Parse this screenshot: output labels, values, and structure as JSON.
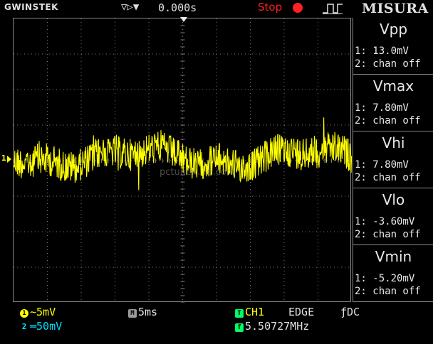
{
  "header": {
    "brand_prefix": "GW",
    "brand_suffix": "INSTEK",
    "timebase_arrows": "▽▷▼",
    "trigger_position": "0.000s",
    "run_state": "Stop",
    "menu_title": "MISURA"
  },
  "measurements": [
    {
      "title": "Vpp",
      "ch1": "1: 13.0mV",
      "ch2": "2: chan off"
    },
    {
      "title": "Vmax",
      "ch1": "1: 7.80mV",
      "ch2": "2: chan off"
    },
    {
      "title": "Vhi",
      "ch1": "1: 7.80mV",
      "ch2": "2: chan off"
    },
    {
      "title": "Vlo",
      "ch1": "1: -3.60mV",
      "ch2": "2: chan off"
    },
    {
      "title": "Vmin",
      "ch1": "1: -5.20mV",
      "ch2": "2: chan off"
    }
  ],
  "status": {
    "ch1_badge": "1",
    "ch1_scale": "~5mV",
    "ch2_badge": "2",
    "ch2_scale": "═50mV",
    "timebase_badge": "M",
    "timebase": "5ms",
    "trigger_badge": "T",
    "trigger_source": "CH1",
    "trigger_type": "EDGE",
    "trigger_coupling": "ƒDC",
    "freq_badge": "f",
    "frequency": "5.50727MHz"
  },
  "waveform": {
    "channel_marker": "1",
    "color": "#ffff00",
    "watermark": "pctuner...re.com"
  },
  "colors": {
    "trace": "#ffff00",
    "ch2": "#00e0ff",
    "trigger_badge": "#00ff66",
    "stop": "#ff2020",
    "grid": "#7a7a7a"
  }
}
